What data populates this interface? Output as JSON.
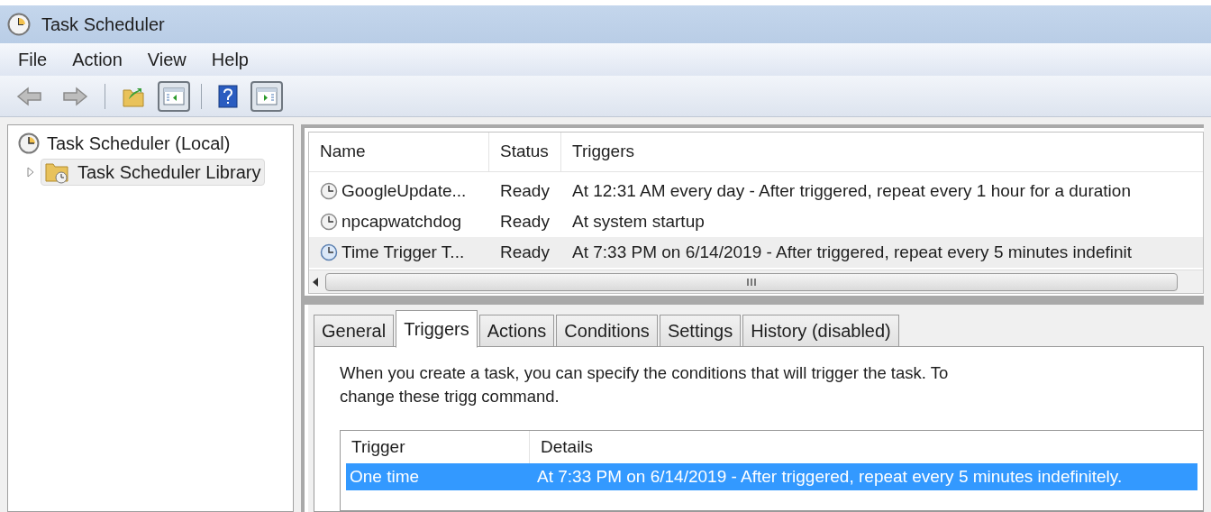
{
  "window": {
    "title": "Task Scheduler"
  },
  "menu": [
    "File",
    "Action",
    "View",
    "Help"
  ],
  "toolbar": [
    {
      "kind": "back"
    },
    {
      "kind": "forward"
    },
    {
      "kind": "separator"
    },
    {
      "kind": "folder"
    },
    {
      "kind": "pane-left",
      "selected": true
    },
    {
      "kind": "separator"
    },
    {
      "kind": "help"
    },
    {
      "kind": "pane-right",
      "selected": true
    }
  ],
  "tree": [
    {
      "label": "Task Scheduler (Local)",
      "kind": "root",
      "selected": false,
      "children": [
        {
          "label": "Task Scheduler Library",
          "kind": "folder",
          "selected": true,
          "expanded": false
        }
      ]
    }
  ],
  "tasks": {
    "columns": [
      "Name",
      "Status",
      "Triggers"
    ],
    "rows": [
      {
        "name": "GoogleUpdate...",
        "status": "Ready",
        "triggers": "At 12:31 AM every day - After triggered, repeat every 1 hour for a duration",
        "selected": false,
        "enabled": false
      },
      {
        "name": "npcapwatchdog",
        "status": "Ready",
        "triggers": "At system startup",
        "selected": false,
        "enabled": false
      },
      {
        "name": "Time Trigger T...",
        "status": "Ready",
        "triggers": "At 7:33 PM on 6/14/2019 - After triggered, repeat every 5 minutes indefinit",
        "selected": true,
        "enabled": true
      }
    ]
  },
  "tabs": [
    {
      "label": "General",
      "selected": false
    },
    {
      "label": "Triggers",
      "selected": true
    },
    {
      "label": "Actions",
      "selected": false
    },
    {
      "label": "Conditions",
      "selected": false
    },
    {
      "label": "Settings",
      "selected": false
    },
    {
      "label": "History (disabled)",
      "selected": false
    }
  ],
  "description": "When you create a task, you can specify the conditions that will trigger the task.  To change these trigg command.",
  "triggers": {
    "columns": [
      "Trigger",
      "Details"
    ],
    "rows": [
      {
        "trigger": "One time",
        "details": "At 7:33 PM on 6/14/2019 - After triggered, repeat every 5 minutes indefinitely.",
        "selected": true
      }
    ]
  }
}
